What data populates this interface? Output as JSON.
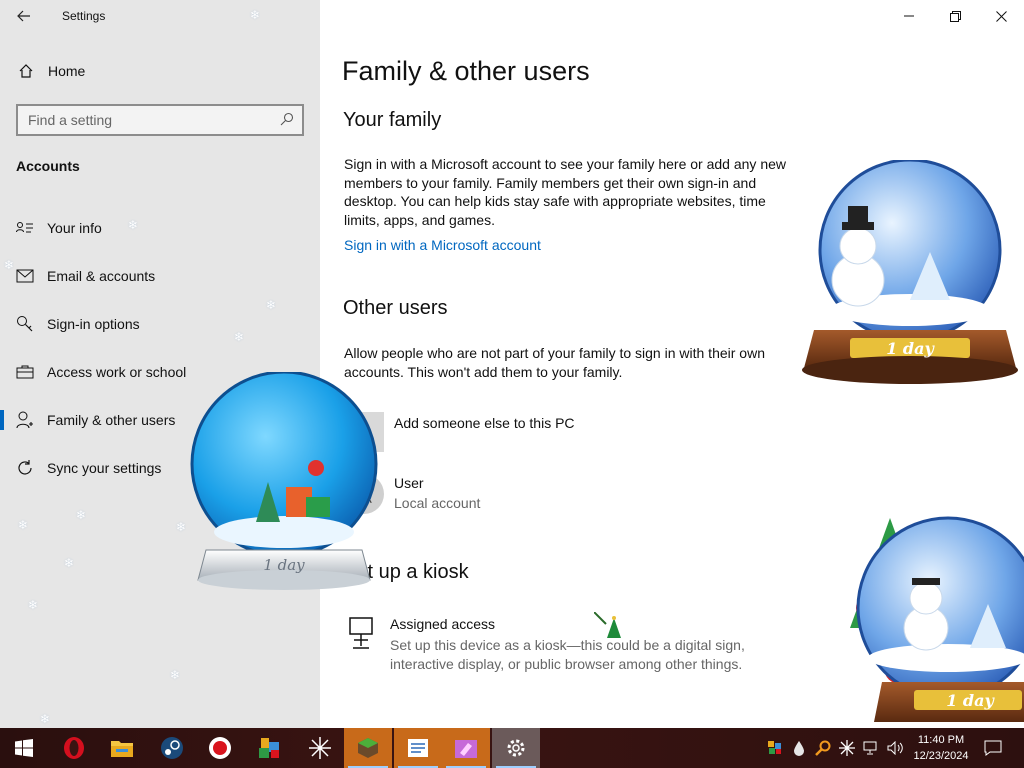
{
  "window": {
    "app_title": "Settings",
    "back_icon": "back-arrow-icon",
    "minimize_icon": "minimize-icon",
    "restore_icon": "restore-icon",
    "close_icon": "close-icon"
  },
  "sidebar": {
    "home_label": "Home",
    "search_placeholder": "Find a setting",
    "section_title": "Accounts",
    "items": [
      {
        "label": "Your info",
        "icon": "contact-card-icon",
        "active": false
      },
      {
        "label": "Email & accounts",
        "icon": "mail-icon",
        "active": false
      },
      {
        "label": "Sign-in options",
        "icon": "key-icon",
        "active": false
      },
      {
        "label": "Access work or school",
        "icon": "briefcase-icon",
        "active": false
      },
      {
        "label": "Family & other users",
        "icon": "family-icon",
        "active": true
      },
      {
        "label": "Sync your settings",
        "icon": "sync-icon",
        "active": false
      }
    ]
  },
  "main": {
    "page_title": "Family & other users",
    "your_family": {
      "heading": "Your family",
      "description": "Sign in with a Microsoft account to see your family here or add any new members to your family. Family members get their own sign-in and desktop. You can help kids stay safe with appropriate websites, time limits, apps, and games.",
      "link": "Sign in with a Microsoft account"
    },
    "other_users": {
      "heading": "Other users",
      "description": "Allow people who are not part of your family to sign in with their own accounts. This won't add them to your family.",
      "add_label": "Add someone else to this PC",
      "user_name": "User",
      "user_type": "Local account"
    },
    "kiosk": {
      "heading": "Set up a kiosk",
      "title": "Assigned access",
      "description": "Set up this device as a kiosk—this could be a digital sign, interactive display, or public browser among other things."
    }
  },
  "decorations": {
    "globe_label": "1 day"
  },
  "taskbar": {
    "apps": [
      "windows-start-icon",
      "opera-icon",
      "file-explorer-icon",
      "steam-icon",
      "record-icon",
      "game-icon",
      "snowflake-app-icon",
      "minecraft-icon",
      "notes-icon",
      "paint-icon",
      "settings-gear-icon"
    ],
    "time": "11:40 PM",
    "date": "12/23/2024"
  },
  "colors": {
    "accent": "#0067c0",
    "sidebar_bg": "#e6e6e6",
    "taskbar_bg": "#2d100f"
  }
}
